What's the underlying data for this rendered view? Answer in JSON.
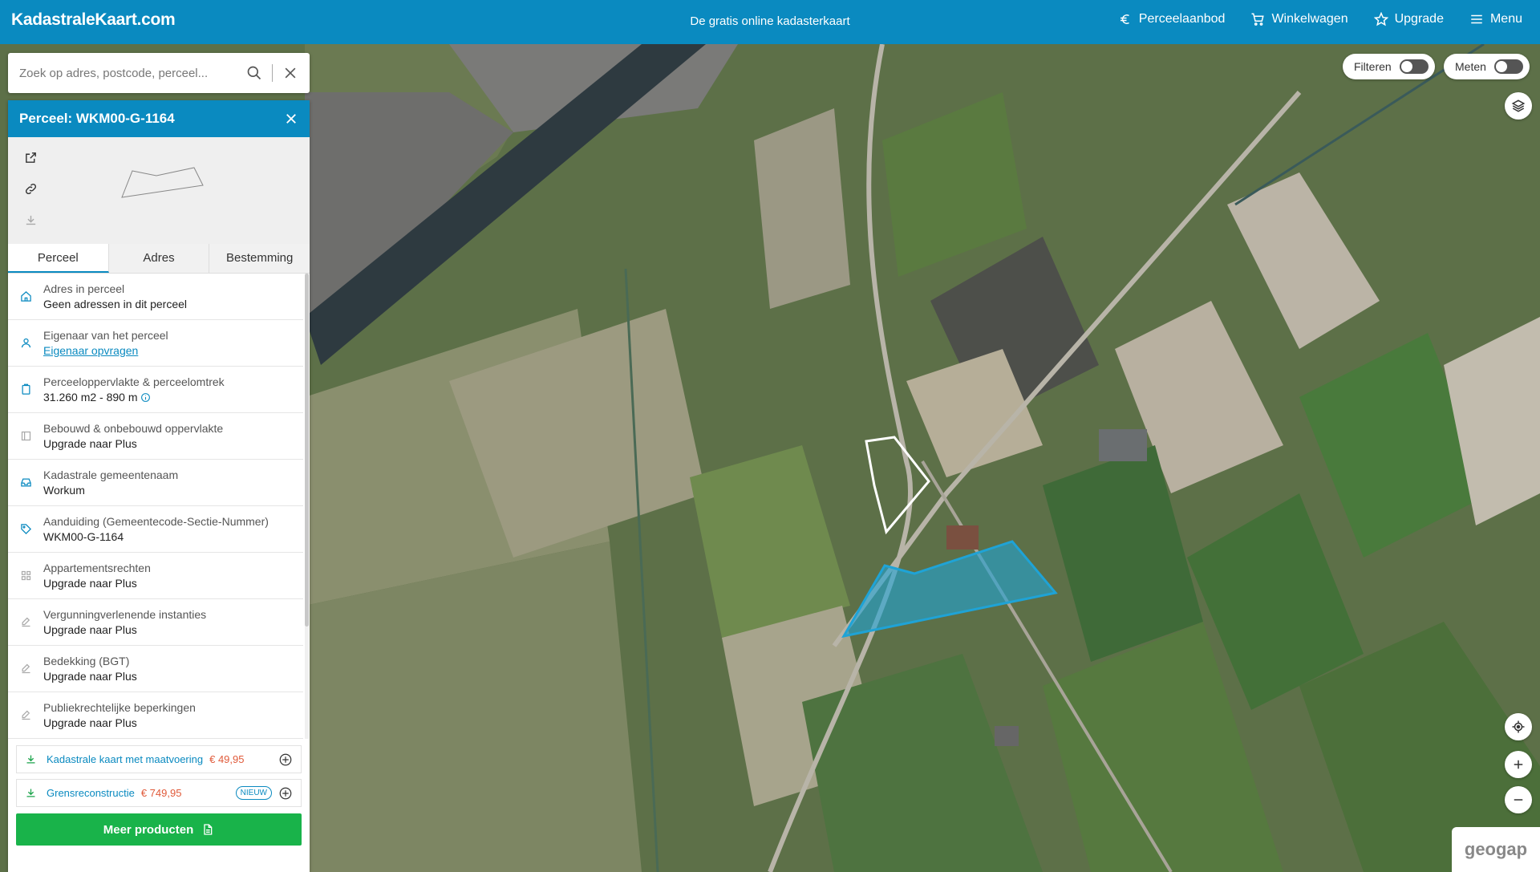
{
  "header": {
    "logo": "KadastraleKaart.com",
    "tagline": "De gratis online kadasterkaart",
    "nav": [
      {
        "label": "Perceelaanbod",
        "icon": "euro-icon"
      },
      {
        "label": "Winkelwagen",
        "icon": "cart-icon"
      },
      {
        "label": "Upgrade",
        "icon": "star-icon"
      },
      {
        "label": "Menu",
        "icon": "menu-icon"
      }
    ]
  },
  "search": {
    "placeholder": "Zoek op adres, postcode, perceel..."
  },
  "panel": {
    "title": "Perceel: WKM00-G-1164",
    "tabs": [
      "Perceel",
      "Adres",
      "Bestemming"
    ],
    "active_tab": "Perceel",
    "items": [
      {
        "label": "Adres in perceel",
        "value": "Geen adressen in dit perceel",
        "icon": "home-icon",
        "color": "#0a8ac0"
      },
      {
        "label": "Eigenaar van het perceel",
        "value": "Eigenaar opvragen",
        "icon": "user-icon",
        "color": "#0a8ac0",
        "link": true
      },
      {
        "label": "Perceeloppervlakte & perceelomtrek",
        "value": "31.260 m2 - 890 m",
        "icon": "clipboard-icon",
        "color": "#0a8ac0",
        "info": true
      },
      {
        "label": "Bebouwd & onbebouwd oppervlakte",
        "value": "Upgrade naar Plus",
        "icon": "building-icon",
        "color": "#aaaaaa"
      },
      {
        "label": "Kadastrale gemeentenaam",
        "value": "Workum",
        "icon": "inbox-icon",
        "color": "#0a8ac0"
      },
      {
        "label": "Aanduiding (Gemeentecode-Sectie-Nummer)",
        "value": "WKM00-G-1164",
        "icon": "tag-icon",
        "color": "#0a8ac0"
      },
      {
        "label": "Appartementsrechten",
        "value": "Upgrade naar Plus",
        "icon": "grid-icon",
        "color": "#aaaaaa"
      },
      {
        "label": "Vergunningverlenende instanties",
        "value": "Upgrade naar Plus",
        "icon": "edit-icon",
        "color": "#aaaaaa"
      },
      {
        "label": "Bedekking (BGT)",
        "value": "Upgrade naar Plus",
        "icon": "edit-icon",
        "color": "#aaaaaa"
      },
      {
        "label": "Publiekrechtelijke beperkingen",
        "value": "Upgrade naar Plus",
        "icon": "edit-icon",
        "color": "#aaaaaa"
      }
    ],
    "products": [
      {
        "name": "Kadastrale kaart met maatvoering",
        "price": "€ 49,95",
        "badge": ""
      },
      {
        "name": "Grensreconstructie",
        "price": "€ 749,95",
        "badge": "NIEUW"
      }
    ],
    "cta": "Meer producten"
  },
  "map_controls": {
    "filter_label": "Filteren",
    "measure_label": "Meten",
    "brand": "geogap"
  },
  "colors": {
    "primary": "#0a8ac0",
    "cta": "#19b34a",
    "price": "#e05a3a",
    "parcel_fill": "#1fa3d6"
  }
}
